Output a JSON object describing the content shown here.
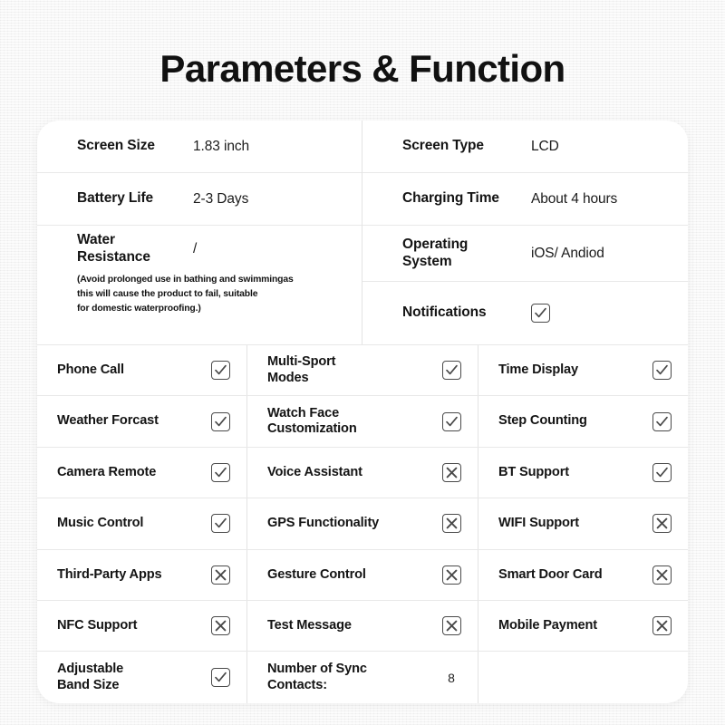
{
  "page": {
    "title": "Parameters & Function",
    "background_color": "#f3f3f3",
    "card_color": "#ffffff",
    "text_color": "#141414"
  },
  "specs": {
    "left": [
      {
        "label": "Screen Size",
        "value": "1.83 inch"
      },
      {
        "label": "Battery Life",
        "value": "2-3 Days"
      },
      {
        "label": "Water\nResistance",
        "value": "/"
      }
    ],
    "left_note": "(Avoid prolonged use in bathing and swimmingas this will cause the product to fail, suitable for domestic waterproofing.)",
    "left_note_lines": [
      "(Avoid prolonged use in bathing and swimmingas",
      "this will cause the product to fail, suitable",
      "for domestic waterproofing.)"
    ],
    "right": [
      {
        "label": "Screen Type",
        "value": "LCD",
        "type": "text"
      },
      {
        "label": "Charging Time",
        "value": "About 4 hours",
        "type": "text"
      },
      {
        "label": "Operating\nSystem",
        "value": "iOS/ Andiod",
        "type": "text"
      },
      {
        "label": "Notifications",
        "value": "check",
        "type": "mark"
      }
    ],
    "labels": {
      "screen_size": "Screen Size",
      "battery_life": "Battery Life",
      "water_resistance_l1": "Water",
      "water_resistance_l2": "Resistance",
      "screen_type": "Screen Type",
      "charging_time": "Charging Time",
      "operating_system_l1": "Operating",
      "operating_system_l2": "System",
      "notifications": "Notifications"
    },
    "values": {
      "screen_size": "1.83 inch",
      "battery_life": "2-3 Days",
      "water_resistance": "/",
      "screen_type": "LCD",
      "charging_time": "About 4 hours",
      "operating_system": "iOS/ Andiod"
    },
    "note_line1": "(Avoid prolonged use in bathing and swimmingas",
    "note_line2": "this will cause the product to fail, suitable",
    "note_line3": "for domestic waterproofing.)"
  },
  "features": {
    "rows": [
      [
        {
          "label": "Phone Call",
          "mark": "check"
        },
        {
          "label": "Multi-Sport\nModes",
          "mark": "check"
        },
        {
          "label": "Time Display",
          "mark": "check"
        }
      ],
      [
        {
          "label": "Weather Forcast",
          "mark": "check"
        },
        {
          "label": "Watch Face\nCustomization",
          "mark": "check"
        },
        {
          "label": "Step Counting",
          "mark": "check"
        }
      ],
      [
        {
          "label": "Camera Remote",
          "mark": "check"
        },
        {
          "label": "Voice Assistant",
          "mark": "cross"
        },
        {
          "label": "BT Support",
          "mark": "check"
        }
      ],
      [
        {
          "label": "Music Control",
          "mark": "check"
        },
        {
          "label": "GPS Functionality",
          "mark": "cross"
        },
        {
          "label": "WIFI Support",
          "mark": "cross"
        }
      ],
      [
        {
          "label": "Third-Party Apps",
          "mark": "cross"
        },
        {
          "label": "Gesture Control",
          "mark": "cross"
        },
        {
          "label": "Smart Door Card",
          "mark": "cross"
        }
      ],
      [
        {
          "label": "NFC Support",
          "mark": "cross"
        },
        {
          "label": "Test Message",
          "mark": "cross"
        },
        {
          "label": "Mobile Payment",
          "mark": "cross"
        }
      ],
      [
        {
          "label": "Adjustable\nBand Size",
          "mark": "check"
        },
        {
          "label": "Number of Sync\nContacts:",
          "mark": "number",
          "value": "8"
        },
        {
          "label": "",
          "mark": "none"
        }
      ]
    ],
    "flat_labels": [
      "Phone Call",
      "Multi-Sport Modes",
      "Time Display",
      "Weather Forcast",
      "Watch Face Customization",
      "Step Counting",
      "Camera Remote",
      "Voice Assistant",
      "BT Support",
      "Music Control",
      "GPS Functionality",
      "WIFI Support",
      "Third-Party Apps",
      "Gesture Control",
      "Smart Door Card",
      "NFC Support",
      "Test Message",
      "Mobile Payment",
      "Adjustable Band Size",
      "Number of Sync Contacts:"
    ],
    "sync_contacts_count": "8",
    "mark_icons": {
      "check": "checkbox-checked-icon",
      "cross": "checkbox-crossed-icon"
    }
  }
}
